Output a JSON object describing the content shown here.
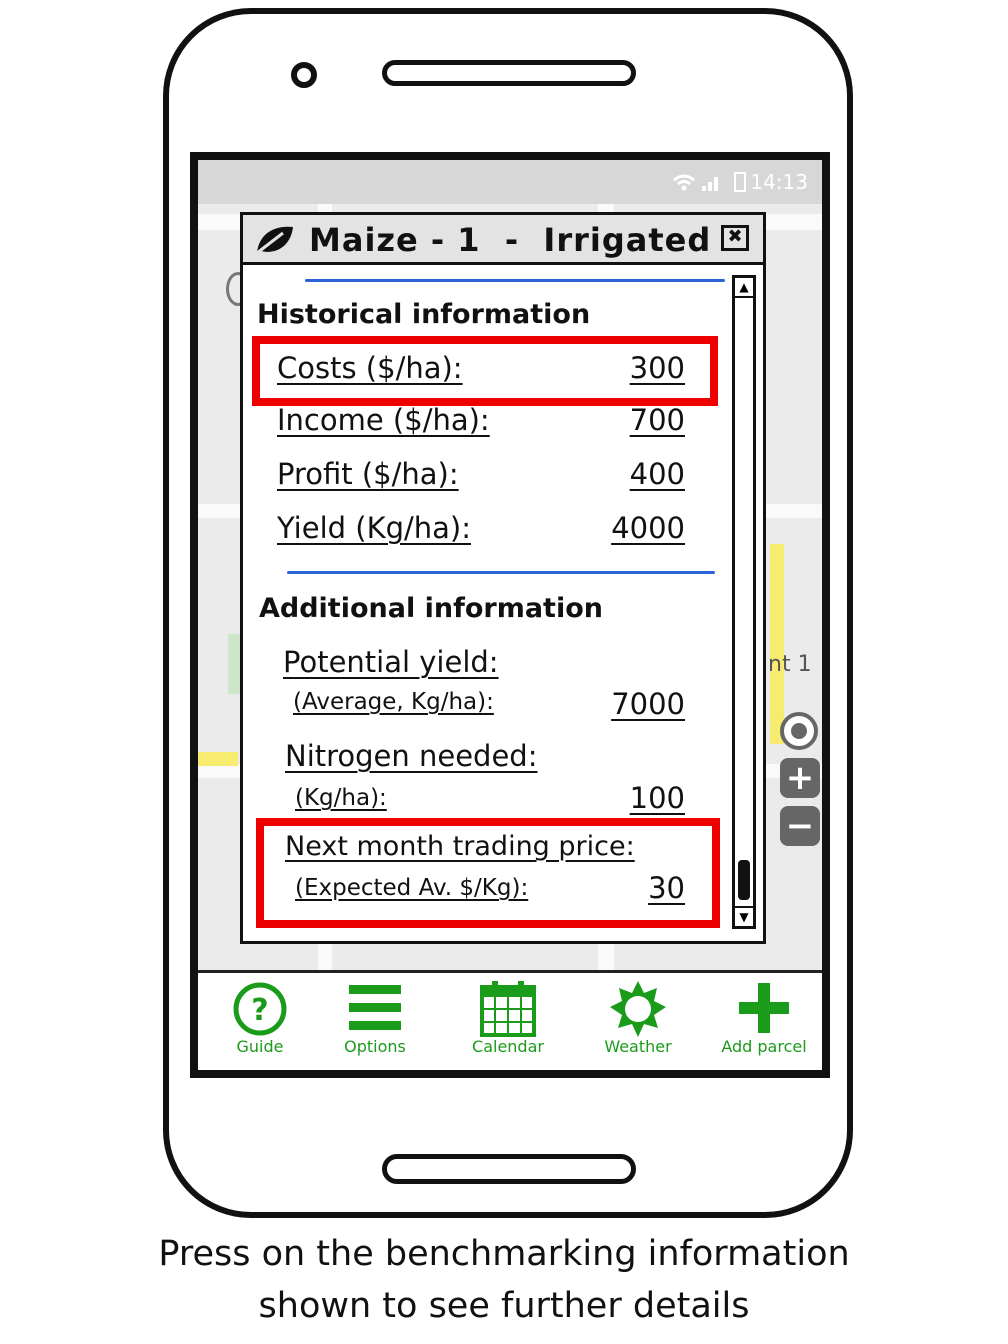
{
  "status_bar": {
    "time": "14:13"
  },
  "map": {
    "label": "nt 1"
  },
  "dialog": {
    "title": "Maize - 1  -  Irrigated",
    "close_symbol": "✖",
    "historical": {
      "heading": "Historical information",
      "rows": [
        {
          "label": "Costs ($/ha):",
          "value": "300"
        },
        {
          "label": "Income ($/ha):",
          "value": "700"
        },
        {
          "label": "Profit ($/ha):",
          "value": "400"
        },
        {
          "label": "Yield (Kg/ha):",
          "value": "4000"
        }
      ]
    },
    "additional": {
      "heading": "Additional information",
      "rows": [
        {
          "label": "Potential yield:",
          "sublabel": "(Average, Kg/ha):",
          "value": "7000"
        },
        {
          "label": "Nitrogen needed:",
          "sublabel": "(Kg/ha):",
          "value": "100"
        },
        {
          "label": "Next month trading price:",
          "sublabel": "(Expected Av. $/Kg):",
          "value": "30"
        }
      ]
    }
  },
  "toolbar": {
    "items": [
      {
        "label": "Guide",
        "icon": "help-circle-icon"
      },
      {
        "label": "Options",
        "icon": "menu-icon"
      },
      {
        "label": "Calendar",
        "icon": "calendar-icon"
      },
      {
        "label": "Weather",
        "icon": "sun-icon"
      },
      {
        "label": "Add parcel",
        "icon": "plus-icon"
      }
    ]
  },
  "caption": {
    "line1": "Press on the benchmarking information",
    "line2": "shown to see further details"
  },
  "colors": {
    "accent_green": "#1a9b1a",
    "highlight_red": "#ee0000",
    "separator_blue": "#2a64d6"
  }
}
